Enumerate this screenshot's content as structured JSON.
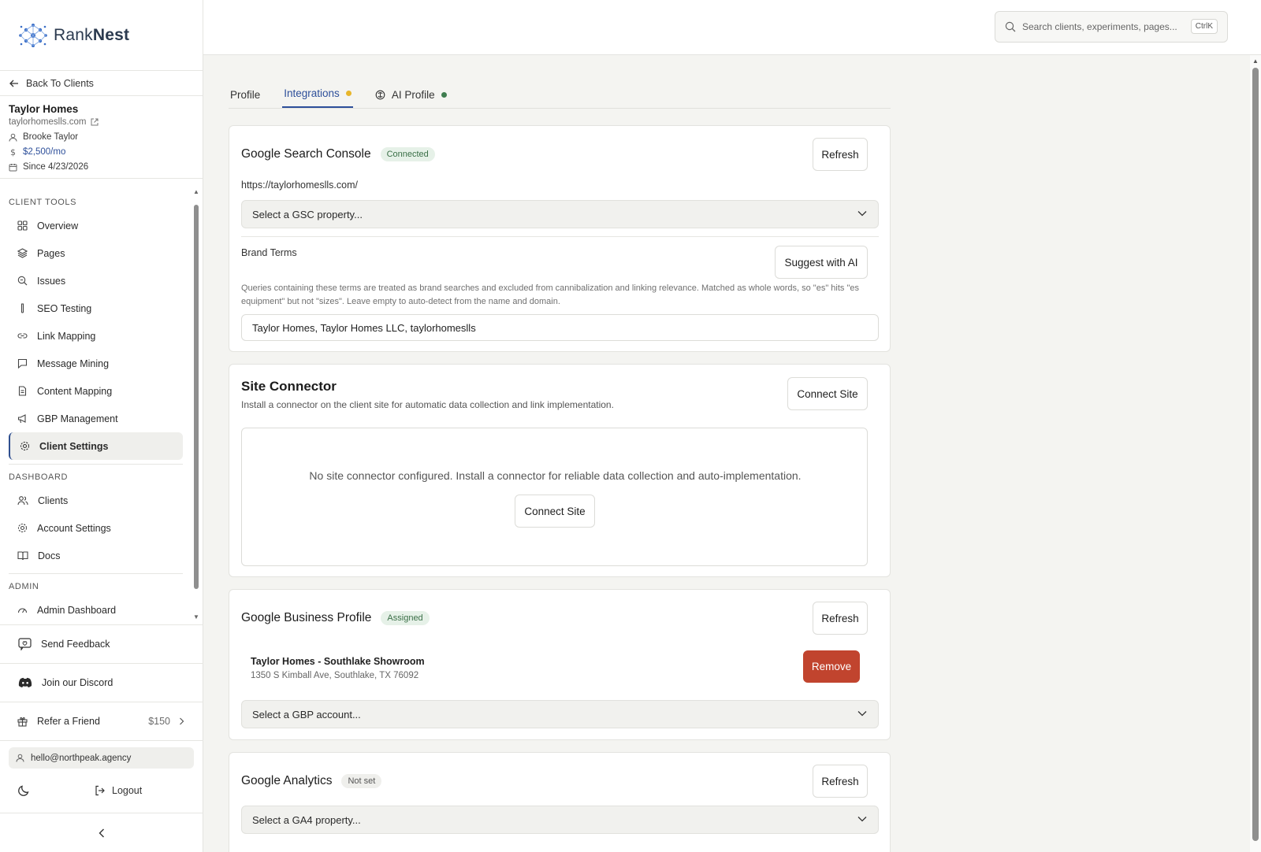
{
  "brand": {
    "name_light": "Rank",
    "name_bold": "Nest"
  },
  "sidebar": {
    "back_label": "Back To Clients",
    "client": {
      "name": "Taylor Homes",
      "domain": "taylorhomeslls.com",
      "contact": "Brooke Taylor",
      "retainer": "$2,500/mo",
      "since": "Since 4/23/2026"
    },
    "sections": [
      {
        "label": "CLIENT TOOLS",
        "items": [
          {
            "label": "Overview",
            "icon": "grid-icon"
          },
          {
            "label": "Pages",
            "icon": "layers-icon"
          },
          {
            "label": "Issues",
            "icon": "search-icon"
          },
          {
            "label": "SEO Testing",
            "icon": "test-tube-icon"
          },
          {
            "label": "Link Mapping",
            "icon": "link-icon"
          },
          {
            "label": "Message Mining",
            "icon": "message-icon"
          },
          {
            "label": "Content Mapping",
            "icon": "document-icon"
          },
          {
            "label": "GBP Management",
            "icon": "megaphone-icon"
          },
          {
            "label": "Client Settings",
            "icon": "gear-icon",
            "active": true
          }
        ]
      },
      {
        "label": "DASHBOARD",
        "items": [
          {
            "label": "Clients",
            "icon": "users-icon"
          },
          {
            "label": "Account Settings",
            "icon": "gear-icon"
          },
          {
            "label": "Docs",
            "icon": "book-icon"
          }
        ]
      },
      {
        "label": "ADMIN",
        "items": [
          {
            "label": "Admin Dashboard",
            "icon": "gauge-icon"
          }
        ]
      }
    ],
    "send_feedback": "Send Feedback",
    "discord": "Join our Discord",
    "refer": {
      "label": "Refer a Friend",
      "amount": "$150"
    },
    "email": "hello@northpeak.agency",
    "logout": "Logout"
  },
  "topbar": {
    "search_placeholder": "Search clients, experiments, pages...",
    "shortcut": "CtrlK"
  },
  "tabs": [
    {
      "label": "Profile"
    },
    {
      "label": "Integrations",
      "active": true,
      "dot": "#e8b62a"
    },
    {
      "label": "AI Profile",
      "dot": "#3f7d4f"
    }
  ],
  "gsc": {
    "title": "Google Search Console",
    "badge": "Connected",
    "refresh": "Refresh",
    "url": "https://taylorhomeslls.com/",
    "select_placeholder": "Select a GSC property...",
    "brand_terms_label": "Brand Terms",
    "suggest": "Suggest with AI",
    "help": "Queries containing these terms are treated as brand searches and excluded from cannibalization and linking relevance. Matched as whole words, so \"es\" hits \"es equipment\" but not \"sizes\". Leave empty to auto-detect from the name and domain.",
    "terms_value": "Taylor Homes, Taylor Homes LLC, taylorhomeslls"
  },
  "connector": {
    "title": "Site Connector",
    "subtitle": "Install a connector on the client site for automatic data collection and link implementation.",
    "connect": "Connect Site",
    "empty": "No site connector configured. Install a connector for reliable data collection and auto-implementation.",
    "connect_inner": "Connect Site"
  },
  "gbp": {
    "title": "Google Business Profile",
    "badge": "Assigned",
    "refresh": "Refresh",
    "location_name": "Taylor Homes - Southlake Showroom",
    "location_address": "1350 S Kimball Ave, Southlake, TX 76092",
    "remove": "Remove",
    "select_placeholder": "Select a GBP account..."
  },
  "ga": {
    "title": "Google Analytics",
    "badge": "Not set",
    "refresh": "Refresh",
    "select_placeholder": "Select a GA4 property..."
  },
  "colors": {
    "accent": "#2d4f9a",
    "danger": "#c1442e",
    "connected_bg": "#e6f1e8",
    "connected_text": "#3a6f47"
  }
}
